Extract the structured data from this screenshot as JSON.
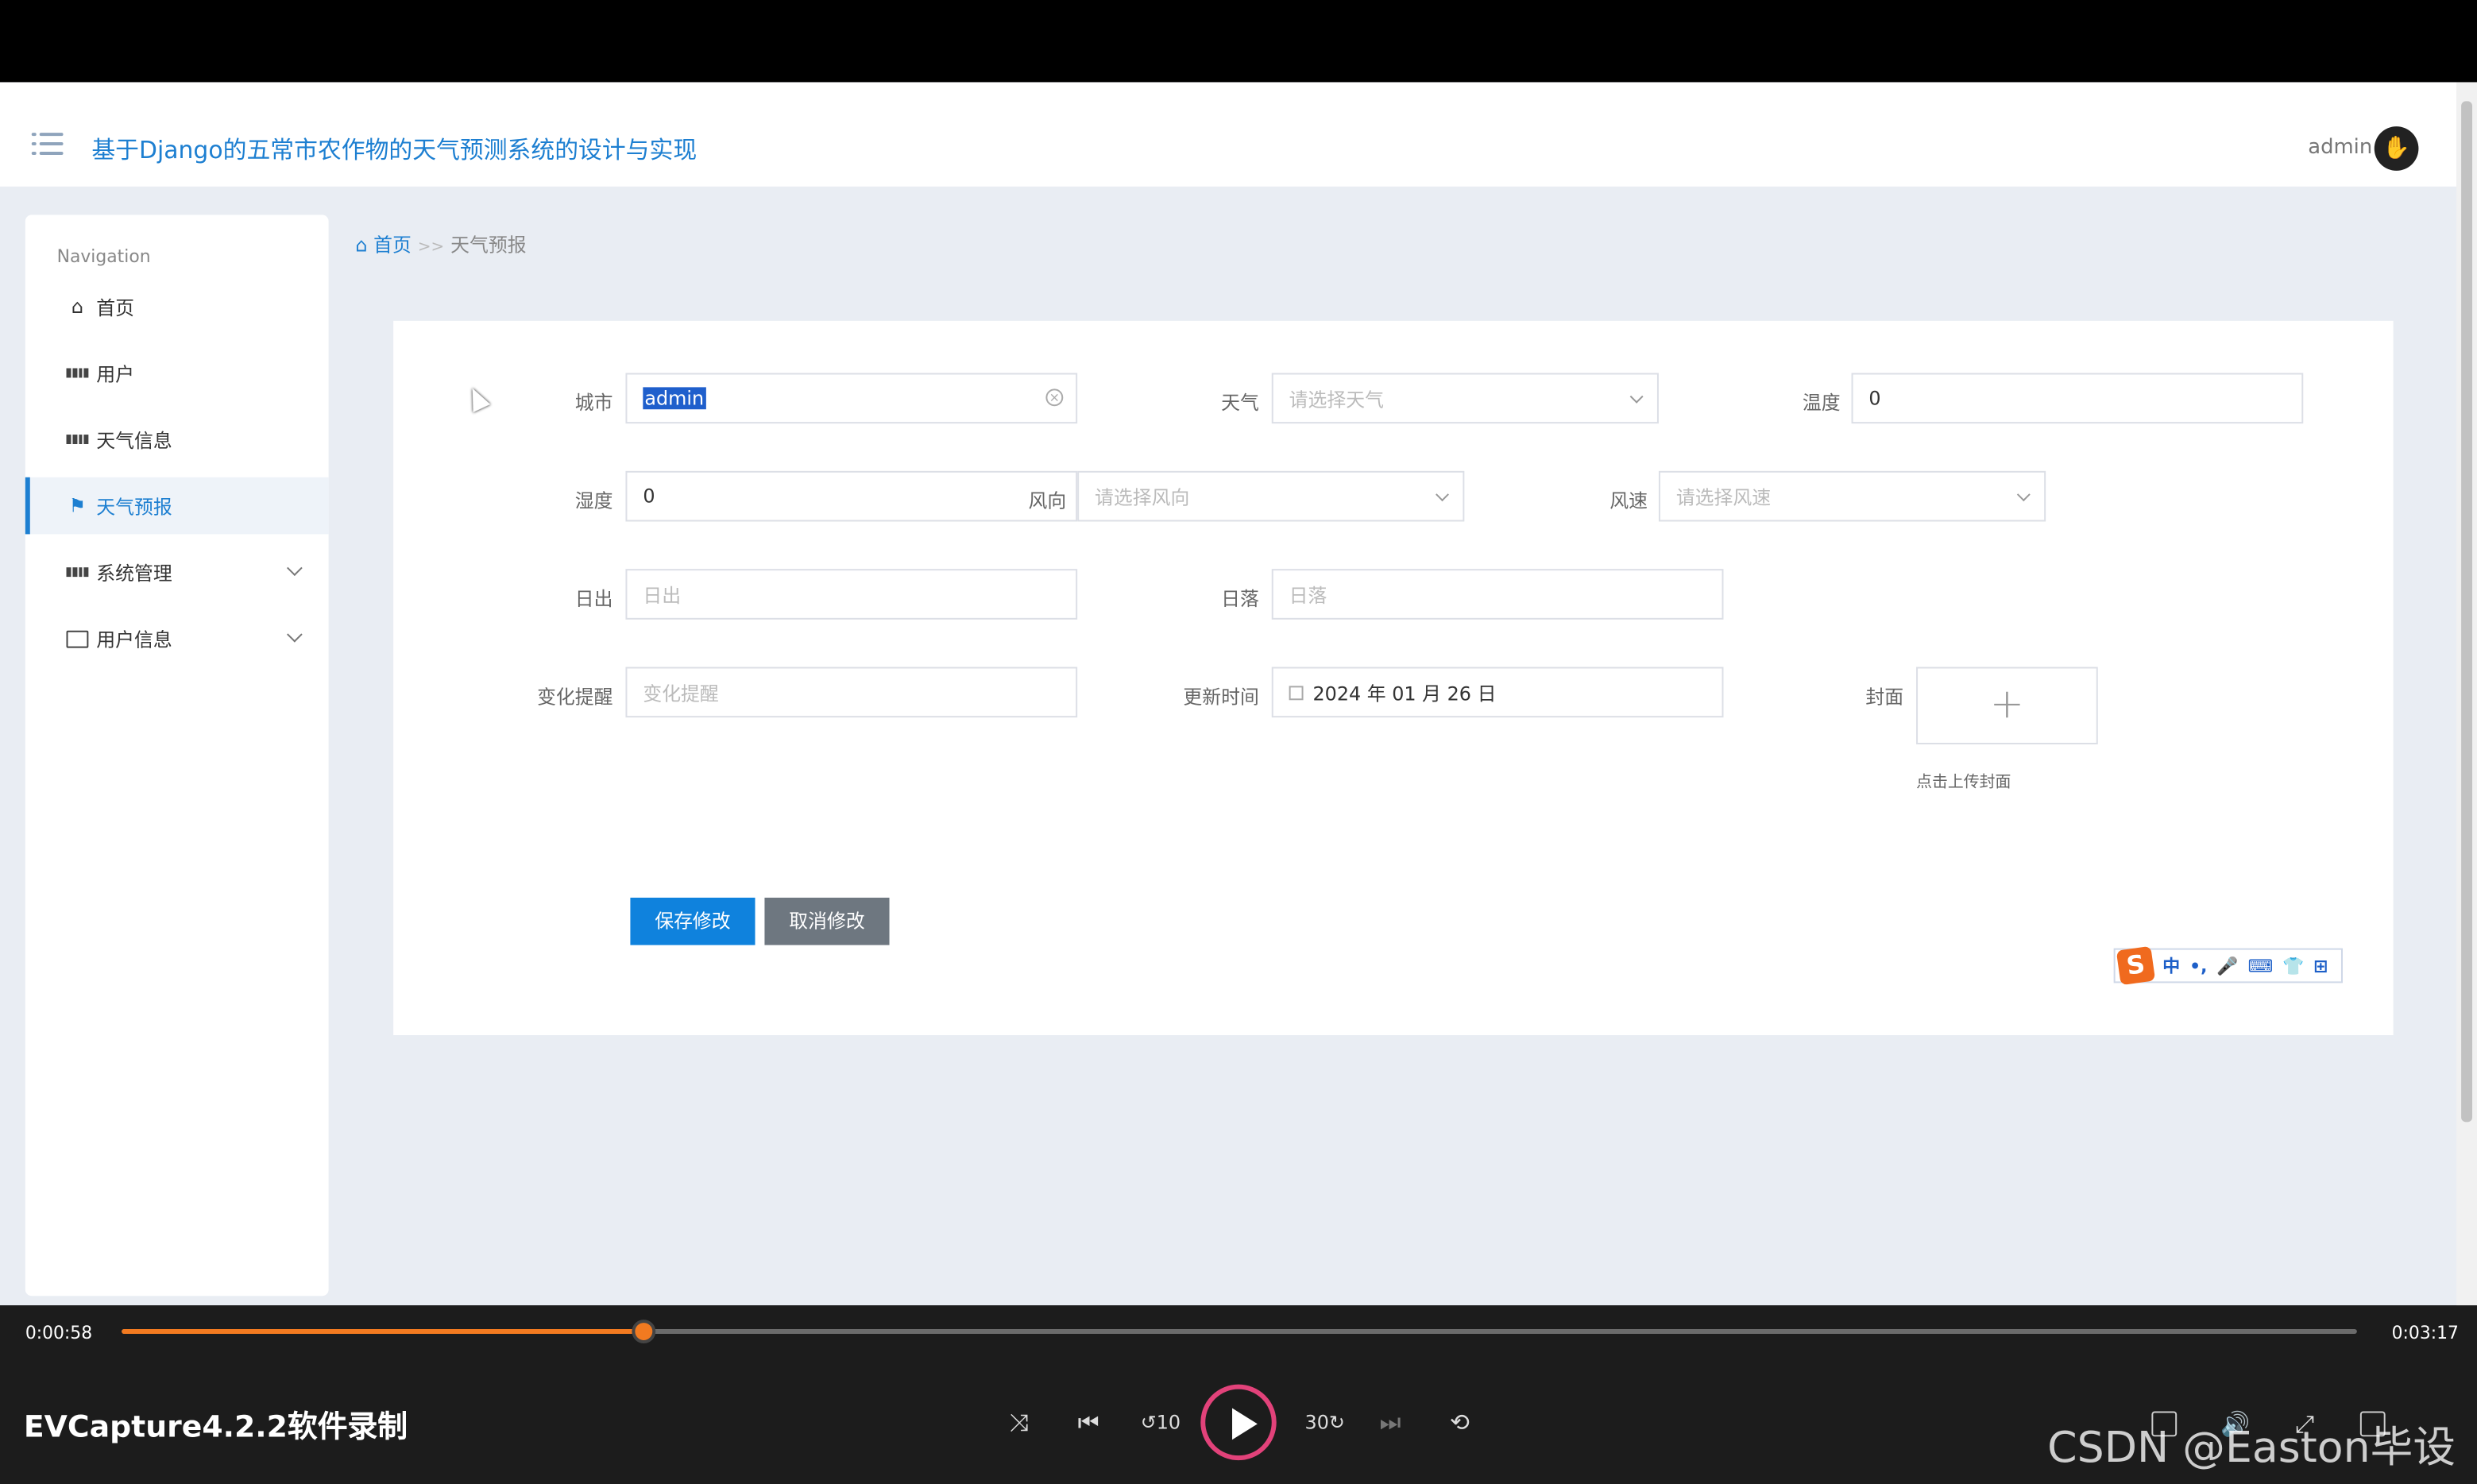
{
  "app": {
    "title": "基于Django的五常市农作物的天气预测系统的设计与实现",
    "user": "admin"
  },
  "sidebar": {
    "heading": "Navigation",
    "items": [
      {
        "label": "首页",
        "icon": "home-icon"
      },
      {
        "label": "用户",
        "icon": "grid-icon"
      },
      {
        "label": "天气信息",
        "icon": "grid-icon"
      },
      {
        "label": "天气预报",
        "icon": "flag-icon",
        "active": true
      },
      {
        "label": "系统管理",
        "icon": "grid-icon",
        "expandable": true
      },
      {
        "label": "用户信息",
        "icon": "card-icon",
        "expandable": true
      }
    ]
  },
  "breadcrumb": {
    "home": "首页",
    "separator": ">>",
    "current": "天气预报"
  },
  "form": {
    "city": {
      "label": "城市",
      "value": "admin"
    },
    "weather": {
      "label": "天气",
      "placeholder": "请选择天气"
    },
    "temperature": {
      "label": "温度",
      "value": "0"
    },
    "humidity": {
      "label": "湿度",
      "value": "0"
    },
    "wind_direction": {
      "label": "风向",
      "placeholder": "请选择风向"
    },
    "wind_speed": {
      "label": "风速",
      "placeholder": "请选择风速"
    },
    "sunrise": {
      "label": "日出",
      "placeholder": "日出"
    },
    "sunset": {
      "label": "日落",
      "placeholder": "日落"
    },
    "change_alert": {
      "label": "变化提醒",
      "placeholder": "变化提醒"
    },
    "update_time": {
      "label": "更新时间",
      "value": "2024 年 01 月 26 日"
    },
    "cover": {
      "label": "封面",
      "note": "点击上传封面"
    },
    "save_label": "保存修改",
    "cancel_label": "取消修改"
  },
  "ime_toolbar": {
    "mode": "中",
    "punct": "•,",
    "logo": "S"
  },
  "player": {
    "current_time": "0:00:58",
    "total_time": "0:03:17",
    "progress": 0.2335,
    "recorder_label": "EVCapture4.2.2软件录制",
    "watermark": "CSDN @Easton毕设",
    "accent": "#f27a20"
  }
}
